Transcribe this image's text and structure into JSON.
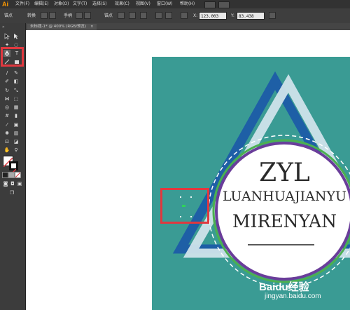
{
  "app": {
    "logo": "Ai"
  },
  "menu": [
    "文件(F)",
    "编辑(E)",
    "对象(O)",
    "文字(T)",
    "选择(S)",
    "效果(C)",
    "视图(V)",
    "窗口(W)",
    "帮助(H)"
  ],
  "options": {
    "label": "锚点",
    "convert_label": "转换",
    "handles_label": "手柄",
    "anchors_label": "锚点",
    "x_value": "123.003",
    "y_value": "83.438"
  },
  "document": {
    "tab_title": "未标题-1* @ 400% (RGB/预览)"
  },
  "artwork": {
    "line1": "ZYL",
    "line2": "LUANHUAJIANYU",
    "line3": "MIRENYAN"
  },
  "watermark": {
    "brand": "Baidu经验",
    "url": "jingyan.baidu.com"
  },
  "colors": {
    "highlight": "#e0383f",
    "artboard_bg": "#3a9b94",
    "triangle_dark": "#1e5fa6",
    "triangle_light": "#cfe3ea",
    "ring_purple": "#6a3d9a",
    "ring_green": "#4caf50"
  }
}
